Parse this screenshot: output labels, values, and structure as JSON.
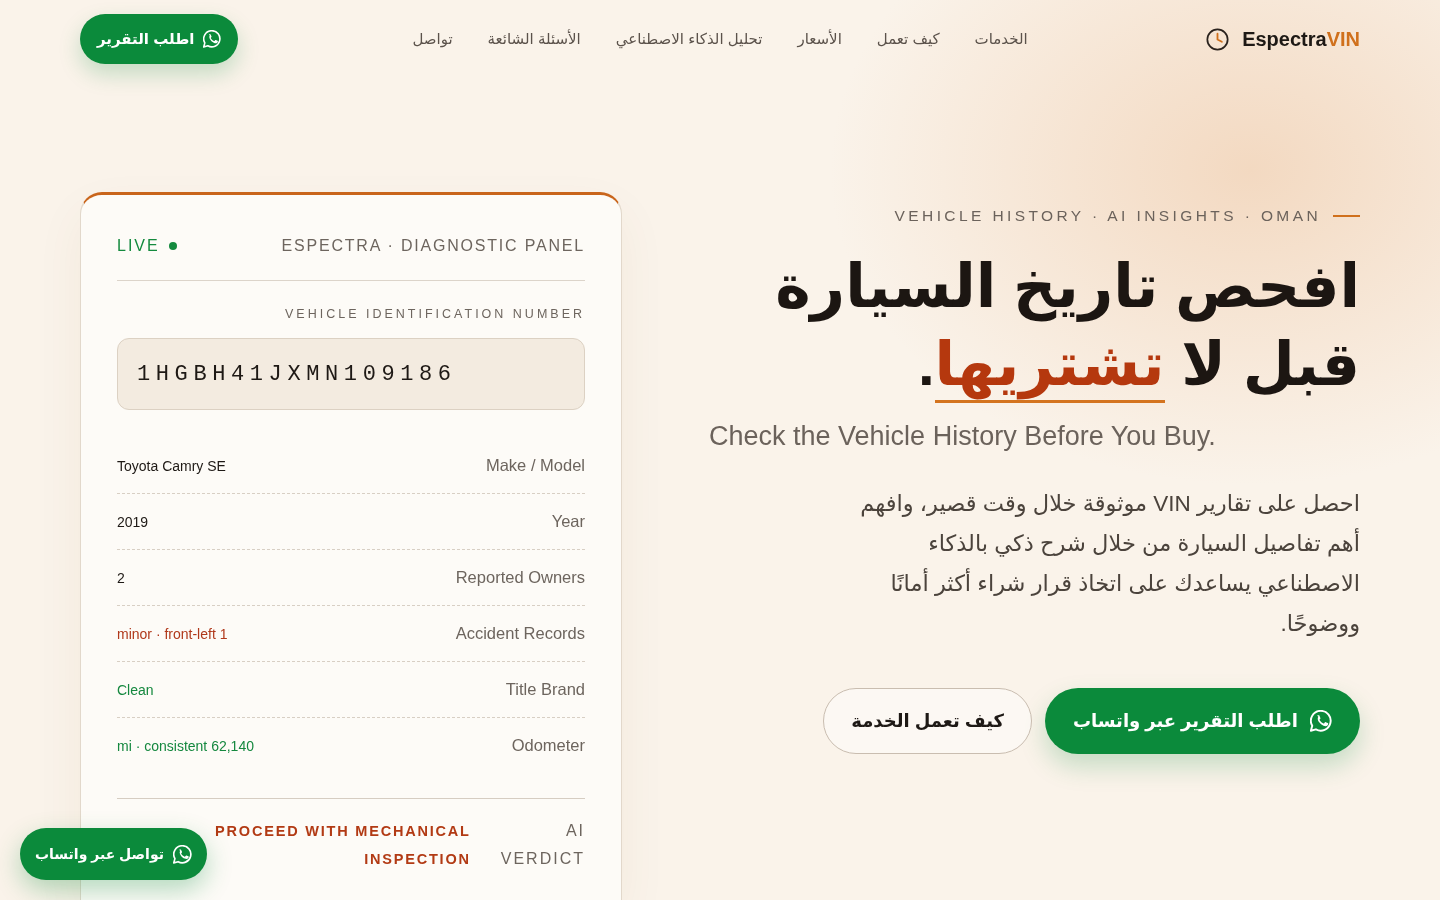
{
  "header": {
    "logo": {
      "name": "Espectra",
      "accent": "VIN"
    },
    "nav": [
      {
        "label": "الخدمات"
      },
      {
        "label": "كيف تعمل"
      },
      {
        "label": "الأسعار"
      },
      {
        "label": "تحليل الذكاء الاصطناعي"
      },
      {
        "label": "الأسئلة الشائعة"
      },
      {
        "label": "تواصل"
      }
    ],
    "cta": {
      "label": "اطلب التقرير"
    }
  },
  "hero": {
    "eyebrow": "VEHICLE HISTORY · AI INSIGHTS · OMAN",
    "heading": {
      "line_1": "افحص تاريخ السيارة",
      "line_2": "قبل لا",
      "highlight": "تشتريها",
      "end": "."
    },
    "subtitle": "Check the Vehicle History Before You Buy.",
    "description": "احصل على تقارير VIN موثوقة خلال وقت قصير، وافهم أهم تفاصيل السيارة من خلال شرح ذكي بالذكاء الاصطناعي يساعدك على اتخاذ قرار شراء أكثر أمانًا ووضوحًا.",
    "buttons": [
      {
        "label": "اطلب التقرير عبر واتساب",
        "kind": "primary"
      },
      {
        "label": "كيف تعمل الخدمة",
        "kind": "secondary"
      }
    ]
  },
  "diagnostic_panel": {
    "status": "LIVE",
    "title": "ESPECTRA · DIAGNOSTIC PANEL",
    "vin_label": "VEHICLE IDENTIFICATION NUMBER",
    "vin": "1HGBH41JXMN109186",
    "rows": [
      {
        "label": "Make / Model",
        "value": "Toyota Camry SE",
        "color": "#1e1915"
      },
      {
        "label": "Year",
        "value": "2019",
        "color": "#1e1915"
      },
      {
        "label": "Reported Owners",
        "value": "2",
        "color": "#1e1915"
      },
      {
        "label": "Accident Records",
        "value": "minor · front-left 1",
        "color": "#b0381a"
      },
      {
        "label": "Title Brand",
        "value": "Clean",
        "color": "#15883f"
      },
      {
        "label": "Odometer",
        "value": "mi · consistent 62,140",
        "color": "#15883f"
      }
    ],
    "verdict": {
      "label": "AI VERDICT",
      "value": "PROCEED WITH MECHANICAL INSPECTION"
    }
  },
  "floating_button": {
    "label": "تواصل عبر واتساب"
  }
}
